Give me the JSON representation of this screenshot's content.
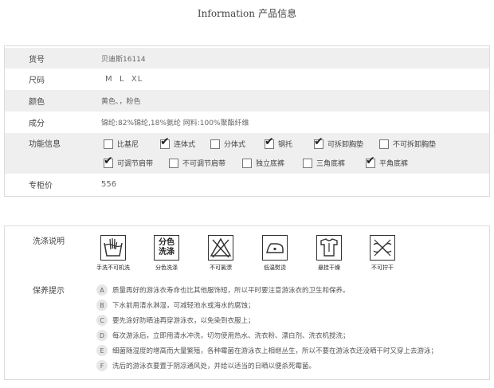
{
  "header": {
    "title_en": "Information",
    "title_zh": "产品信息"
  },
  "info": {
    "item_no": {
      "label": "货号",
      "value": "贝迪斯16114"
    },
    "size": {
      "label": "尺码",
      "value": "M  L  XL"
    },
    "color": {
      "label": "颜色",
      "value": "黄色、，粉色"
    },
    "material": {
      "label": "成分",
      "value": "锦纶:82%锦纶,18%氨纶 网料:100%聚酯纤维"
    },
    "features": {
      "label": "功能信息",
      "options": [
        {
          "label": "比基尼",
          "checked": false
        },
        {
          "label": "连体式",
          "checked": true
        },
        {
          "label": "分体式",
          "checked": false
        },
        {
          "label": "钢托",
          "checked": true
        },
        {
          "label": "可拆卸胸垫",
          "checked": true
        },
        {
          "label": "不可拆卸胸垫",
          "checked": false
        },
        {
          "label": "可调节肩带",
          "checked": true
        },
        {
          "label": "不可调节肩带",
          "checked": false
        },
        {
          "label": "独立底裤",
          "checked": false
        },
        {
          "label": "三角底裤",
          "checked": false
        },
        {
          "label": "平角底裤",
          "checked": true
        }
      ]
    },
    "price": {
      "label": "专柜价",
      "value": "556"
    }
  },
  "care": {
    "label": "洗涤说明",
    "icons": [
      {
        "name": "hand-wash-icon",
        "caption": "手洗不可机洗"
      },
      {
        "name": "separate-wash-icon",
        "caption": "分色洗涤",
        "symbol_line1": "分色",
        "symbol_line2": "洗涤"
      },
      {
        "name": "no-bleach-icon",
        "caption": "不可氯漂"
      },
      {
        "name": "low-iron-icon",
        "caption": "低温熨烫"
      },
      {
        "name": "hang-dry-icon",
        "caption": "悬挂干燥"
      },
      {
        "name": "no-wring-icon",
        "caption": "不可拧干"
      }
    ]
  },
  "maintenance": {
    "label": "保养提示",
    "tips": [
      {
        "letter": "A",
        "text": "质量再好的游泳衣寿命也比其他服饰短，所以平时要注意游泳衣的卫生和保养。"
      },
      {
        "letter": "B",
        "text": "下水前用清水淋湿，可减轻池水或海水的腐蚀；"
      },
      {
        "letter": "C",
        "text": "要先涂好防晒油再穿游泳衣，以免染到衣服上；"
      },
      {
        "letter": "D",
        "text": "每次游泳后，立即用清水冲洗，切勿使用热水、洗衣粉、漂白剂、洗衣机搅洗；"
      },
      {
        "letter": "E",
        "text": "细菌随湿度的增高而大量繁殖，各种霉菌在游泳衣上相继丛生，所以不要在游泳衣还没晒干时又穿上去游泳；"
      },
      {
        "letter": "F",
        "text": "洗后的游泳衣要置于阴凉通风处，并给以适当的日晒以便杀死霉菌。"
      }
    ]
  }
}
